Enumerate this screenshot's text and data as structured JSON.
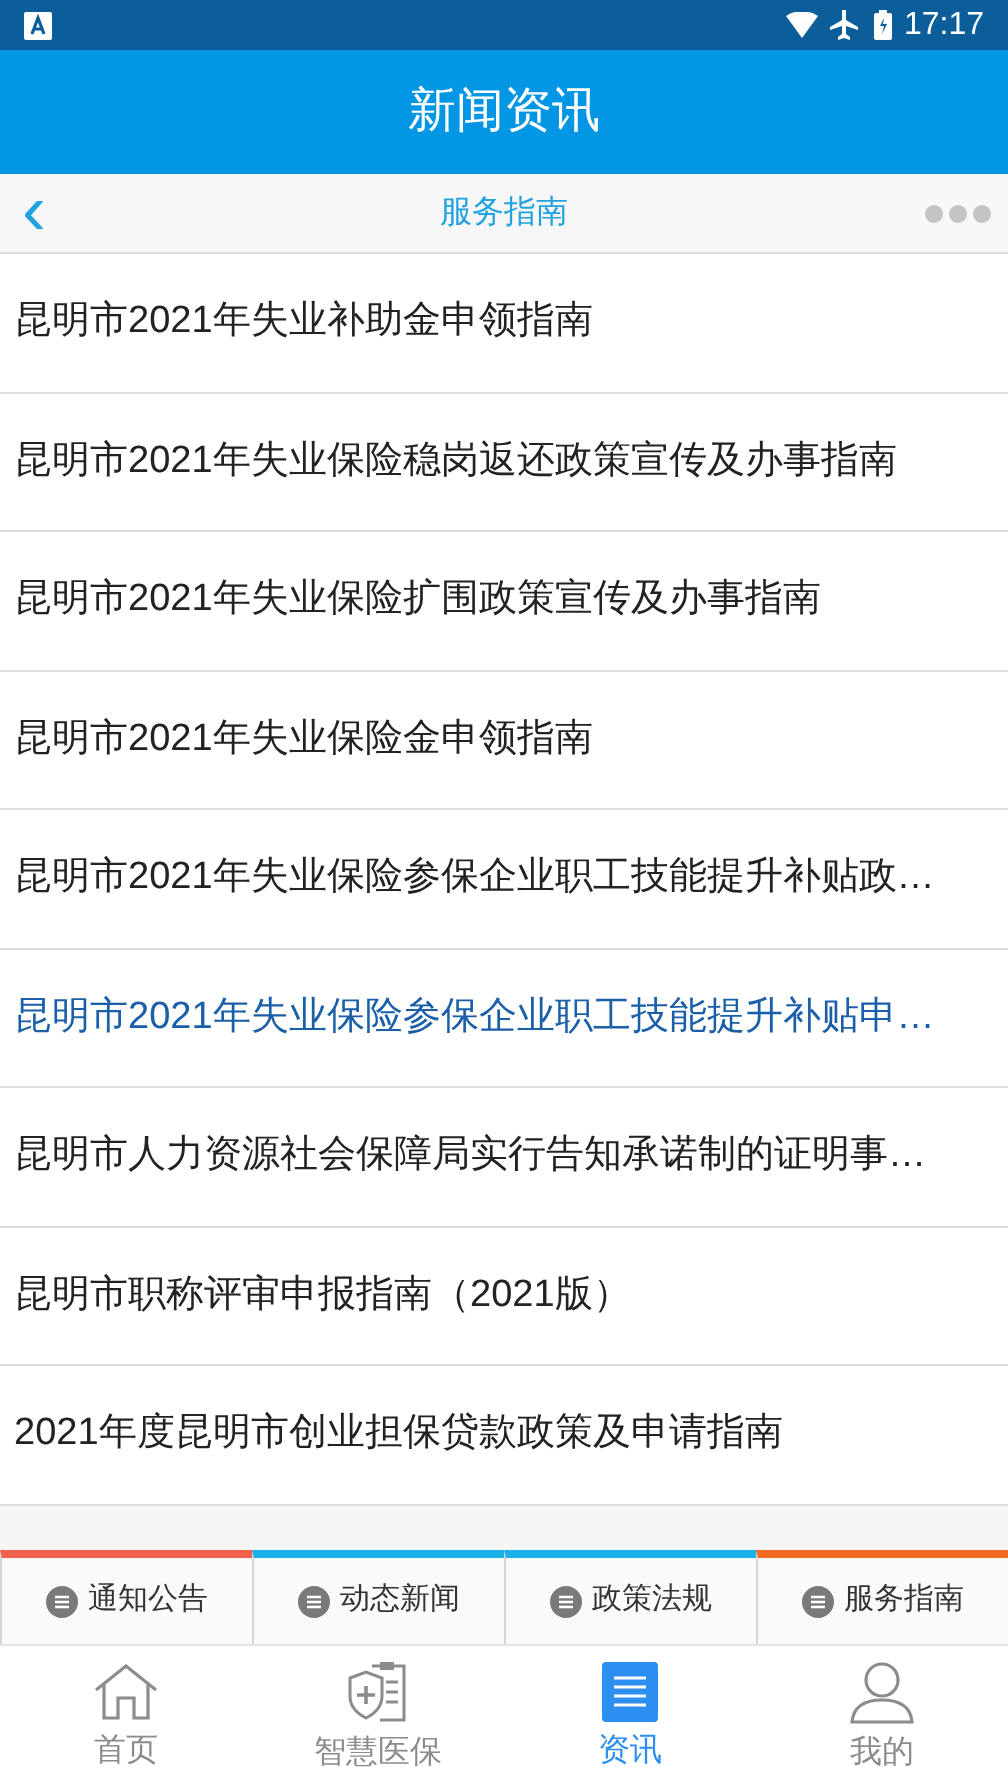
{
  "status_bar": {
    "time": "17:17"
  },
  "header": {
    "title": "新闻资讯"
  },
  "sub_header": {
    "back": "‹",
    "title": "服务指南"
  },
  "articles": [
    {
      "title": "昆明市2021年失业补助金申领指南",
      "selected": false
    },
    {
      "title": "昆明市2021年失业保险稳岗返还政策宣传及办事指南",
      "selected": false
    },
    {
      "title": "昆明市2021年失业保险扩围政策宣传及办事指南",
      "selected": false
    },
    {
      "title": "昆明市2021年失业保险金申领指南",
      "selected": false
    },
    {
      "title": "昆明市2021年失业保险参保企业职工技能提升补贴政…",
      "selected": false
    },
    {
      "title": "昆明市2021年失业保险参保企业职工技能提升补贴申…",
      "selected": true
    },
    {
      "title": "昆明市人力资源社会保障局实行告知承诺制的证明事…",
      "selected": false
    },
    {
      "title": "昆明市职称评审申报指南（2021版）",
      "selected": false
    },
    {
      "title": "2021年度昆明市创业担保贷款政策及申请指南",
      "selected": false
    }
  ],
  "category_tabs": [
    {
      "label": "通知公告",
      "color": "#f0604a"
    },
    {
      "label": "动态新闻",
      "color": "#1ab0e8"
    },
    {
      "label": "政策法规",
      "color": "#1ab0e8"
    },
    {
      "label": "服务指南",
      "color": "#f26a21"
    }
  ],
  "bottom_nav": [
    {
      "label": "首页",
      "kind": "home",
      "selected": false
    },
    {
      "label": "智慧医保",
      "kind": "medical",
      "selected": false
    },
    {
      "label": "资讯",
      "kind": "news",
      "selected": true
    },
    {
      "label": "我的",
      "kind": "profile",
      "selected": false
    }
  ]
}
